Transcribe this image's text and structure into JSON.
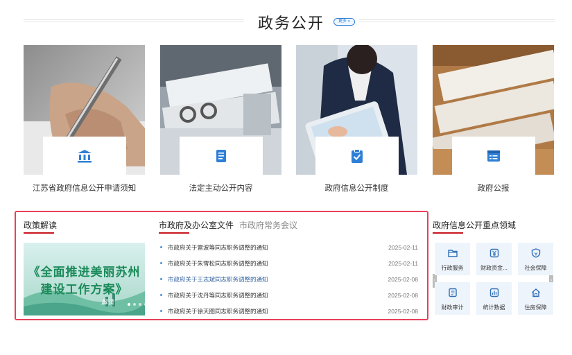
{
  "section": {
    "title": "政务公开",
    "more_label": "更多 »"
  },
  "cards": [
    {
      "label": "江苏省政府信息公开申请须知",
      "icon": "government-building-icon"
    },
    {
      "label": "法定主动公开内容",
      "icon": "document-icon"
    },
    {
      "label": "政府信息公开制度",
      "icon": "clipboard-check-icon"
    },
    {
      "label": "政府公报",
      "icon": "bulletin-icon"
    }
  ],
  "policy": {
    "heading": "政策解读",
    "banner": {
      "line1": "《全面推进美丽苏州",
      "line2": "建设工作方案》",
      "tag": "解读"
    }
  },
  "docs": {
    "tabs": [
      "市政府及办公室文件",
      "市政府常务会议"
    ],
    "items": [
      {
        "title": "市政府关于雷波等同志职务调整的通知",
        "date": "2025-02-11"
      },
      {
        "title": "市政府关于朱雪松同志职务调整的通知",
        "date": "2025-02-11"
      },
      {
        "title": "市政府关于王志斌同志职务调整的通知",
        "date": "2025-02-08"
      },
      {
        "title": "市政府关于沈丹等同志职务调整的通知",
        "date": "2025-02-08"
      },
      {
        "title": "市政府关于徐天图同志职务调整的通知",
        "date": "2025-02-08"
      }
    ]
  },
  "key_areas": {
    "heading": "政府信息公开重点领域",
    "tiles": [
      {
        "label": "行政服务",
        "icon": "folder-icon"
      },
      {
        "label": "财政资金...",
        "icon": "yuan-icon"
      },
      {
        "label": "社会保障",
        "icon": "shield-icon"
      },
      {
        "label": "财政审计",
        "icon": "audit-icon"
      },
      {
        "label": "统计数据",
        "icon": "bar-chart-icon"
      },
      {
        "label": "住房保障",
        "icon": "house-icon"
      }
    ]
  },
  "colors": {
    "accent_red": "#c8161d",
    "icon_blue": "#2f7fd6",
    "frame_red": "#e8405a"
  }
}
